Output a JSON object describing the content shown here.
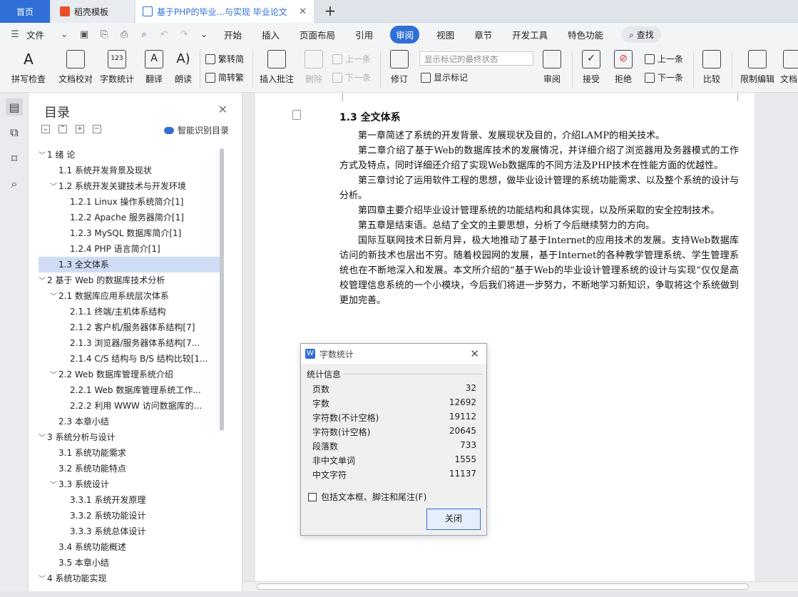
{
  "tabs": {
    "home": "首页",
    "daoke": "稻壳模板",
    "doc": "基于PHP的毕业...与实现 毕业论文",
    "add": "+"
  },
  "menu": {
    "file": "文件",
    "items": [
      "开始",
      "插入",
      "页面布局",
      "引用",
      "审阅",
      "视图",
      "章节",
      "开发工具",
      "特色功能"
    ],
    "active_index": 4,
    "search": "查找"
  },
  "ribbon": {
    "spell_check": "拼写检查",
    "doc_proof": "文档校对",
    "word_count": "字数统计",
    "translate": "翻译",
    "read_aloud": "朗读",
    "trad_to_simp": "繁转简",
    "simp_to_trad": "简转繁",
    "insert_comment": "插入批注",
    "delete": "删除",
    "prev": "上一条",
    "next": "下一条",
    "revise": "修订",
    "markup_select": "显示标记的最终状态",
    "show_markup": "显示标记",
    "review": "审阅",
    "accept": "接受",
    "reject": "拒绝",
    "prev2": "上一条",
    "next2": "下一条",
    "compare": "比较",
    "restrict_edit": "限制编辑",
    "doc_truncated": "文档"
  },
  "toc": {
    "title": "目录",
    "smart": "智能识别目录",
    "items": [
      {
        "text": "1 绪  论",
        "level": 0,
        "arrow": "﹀"
      },
      {
        "text": "1.1  系统开发背景及现状",
        "level": 1,
        "arrow": ""
      },
      {
        "text": "1.2  系统开发关键技术与开发环境",
        "level": 1,
        "arrow": "﹀"
      },
      {
        "text": "1.2.1 Linux 操作系统简介[1]",
        "level": 2,
        "arrow": ""
      },
      {
        "text": "1.2.2 Apache 服务器简介[1]",
        "level": 2,
        "arrow": ""
      },
      {
        "text": "1.2.3 MySQL 数据库简介[1]",
        "level": 2,
        "arrow": ""
      },
      {
        "text": "1.2.4 PHP 语言简介[1]",
        "level": 2,
        "arrow": ""
      },
      {
        "text": "1.3  全文体系",
        "level": 1,
        "arrow": "",
        "selected": true
      },
      {
        "text": "2  基于 Web 的数据库技术分析",
        "level": 0,
        "arrow": "﹀"
      },
      {
        "text": "2.1  数据库应用系统层次体系",
        "level": 1,
        "arrow": "﹀"
      },
      {
        "text": "2.1.1  终端/主机体系结构",
        "level": 2,
        "arrow": ""
      },
      {
        "text": "2.1.2  客户机/服务器体系结构[7]",
        "level": 2,
        "arrow": ""
      },
      {
        "text": "2.1.3  浏览器/服务器体系结构[7...",
        "level": 2,
        "arrow": ""
      },
      {
        "text": "2.1.4 C/S 结构与 B/S 结构比较[1...",
        "level": 2,
        "arrow": ""
      },
      {
        "text": "2.2 Web 数据库管理系统介绍",
        "level": 1,
        "arrow": "﹀"
      },
      {
        "text": "2.2.1 Web 数据库管理系统工作...",
        "level": 2,
        "arrow": ""
      },
      {
        "text": "2.2.2  利用 WWW 访问数据库的...",
        "level": 2,
        "arrow": ""
      },
      {
        "text": "2.3  本章小结",
        "level": 1,
        "arrow": ""
      },
      {
        "text": "3  系统分析与设计",
        "level": 0,
        "arrow": "﹀"
      },
      {
        "text": "3.1  系统功能需求",
        "level": 1,
        "arrow": ""
      },
      {
        "text": "3.2  系统功能特点",
        "level": 1,
        "arrow": ""
      },
      {
        "text": "3.3  系统设计",
        "level": 1,
        "arrow": "﹀"
      },
      {
        "text": "3.3.1  系统开发原理",
        "level": 2,
        "arrow": ""
      },
      {
        "text": "3.3.2  系统功能设计",
        "level": 2,
        "arrow": ""
      },
      {
        "text": "3.3.3  系统总体设计",
        "level": 2,
        "arrow": ""
      },
      {
        "text": "3.4  系统功能概述",
        "level": 1,
        "arrow": ""
      },
      {
        "text": "3.5  本章小结",
        "level": 1,
        "arrow": ""
      },
      {
        "text": "4  系统功能实现",
        "level": 0,
        "arrow": "﹀"
      }
    ]
  },
  "document": {
    "heading": "1.3  全文体系",
    "paragraphs": [
      "第一章简述了系统的开发背景、发展现状及目的，介绍LAMP的相关技术。",
      "第二章介绍了基于Web的数据库技术的发展情况，并详细介绍了浏览器用及务器模式的工作方式及特点，同时详细还介绍了实现Web数据库的不同方法及PHP技术在性能方面的优越性。",
      "第三章讨论了运用软件工程的思想，做毕业设计管理的系统功能需求、以及整个系统的设计与分析。",
      "第四章主要介绍毕业设计管理系统的功能结构和具体实现，以及所采取的安全控制技术。",
      "第五章是结束语。总结了全文的主要思想，分析了今后继续努力的方向。",
      "国际互联网技术日新月异，极大地推动了基于Internet的应用技术的发展。支持Web数据库访问的新技术也层出不穷。随着校园网的发展，基于Internet的各种教学管理系统、学生管理系统也在不断地深入和发展。本文所介绍的“基于Web的毕业设计管理系统的设计与实现”仅仅是高校管理信息系统的一个小模块，今后我们将进一步努力，不断地学习新知识，争取将这个系统做到更加完善。"
    ]
  },
  "dialog": {
    "title": "字数统计",
    "section": "统计信息",
    "stats": [
      {
        "label": "页数",
        "value": "32"
      },
      {
        "label": "字数",
        "value": "12692"
      },
      {
        "label": "字符数(不计空格)",
        "value": "19112"
      },
      {
        "label": "字符数(计空格)",
        "value": "20645"
      },
      {
        "label": "段落数",
        "value": "733"
      },
      {
        "label": "非中文单词",
        "value": "1555"
      },
      {
        "label": "中文字符",
        "value": "11137"
      }
    ],
    "checkbox": "包括文本框、脚注和尾注(F)",
    "close": "关闭"
  },
  "colors": {
    "accent": "#2f6fd6",
    "selected_toc": "#cfdcf5"
  }
}
